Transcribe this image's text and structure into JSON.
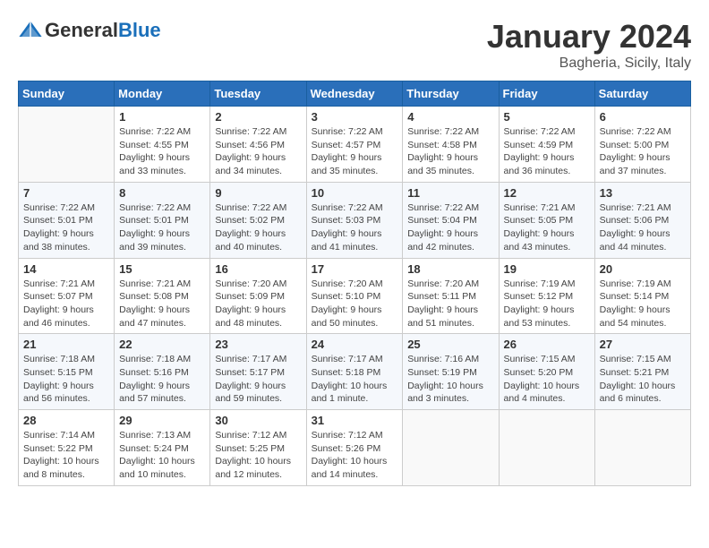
{
  "header": {
    "logo_general": "General",
    "logo_blue": "Blue",
    "month_title": "January 2024",
    "location": "Bagheria, Sicily, Italy"
  },
  "weekdays": [
    "Sunday",
    "Monday",
    "Tuesday",
    "Wednesday",
    "Thursday",
    "Friday",
    "Saturday"
  ],
  "weeks": [
    [
      {
        "day": "",
        "sunrise": "",
        "sunset": "",
        "daylight": ""
      },
      {
        "day": "1",
        "sunrise": "Sunrise: 7:22 AM",
        "sunset": "Sunset: 4:55 PM",
        "daylight": "Daylight: 9 hours and 33 minutes."
      },
      {
        "day": "2",
        "sunrise": "Sunrise: 7:22 AM",
        "sunset": "Sunset: 4:56 PM",
        "daylight": "Daylight: 9 hours and 34 minutes."
      },
      {
        "day": "3",
        "sunrise": "Sunrise: 7:22 AM",
        "sunset": "Sunset: 4:57 PM",
        "daylight": "Daylight: 9 hours and 35 minutes."
      },
      {
        "day": "4",
        "sunrise": "Sunrise: 7:22 AM",
        "sunset": "Sunset: 4:58 PM",
        "daylight": "Daylight: 9 hours and 35 minutes."
      },
      {
        "day": "5",
        "sunrise": "Sunrise: 7:22 AM",
        "sunset": "Sunset: 4:59 PM",
        "daylight": "Daylight: 9 hours and 36 minutes."
      },
      {
        "day": "6",
        "sunrise": "Sunrise: 7:22 AM",
        "sunset": "Sunset: 5:00 PM",
        "daylight": "Daylight: 9 hours and 37 minutes."
      }
    ],
    [
      {
        "day": "7",
        "sunrise": "Sunrise: 7:22 AM",
        "sunset": "Sunset: 5:01 PM",
        "daylight": "Daylight: 9 hours and 38 minutes."
      },
      {
        "day": "8",
        "sunrise": "Sunrise: 7:22 AM",
        "sunset": "Sunset: 5:01 PM",
        "daylight": "Daylight: 9 hours and 39 minutes."
      },
      {
        "day": "9",
        "sunrise": "Sunrise: 7:22 AM",
        "sunset": "Sunset: 5:02 PM",
        "daylight": "Daylight: 9 hours and 40 minutes."
      },
      {
        "day": "10",
        "sunrise": "Sunrise: 7:22 AM",
        "sunset": "Sunset: 5:03 PM",
        "daylight": "Daylight: 9 hours and 41 minutes."
      },
      {
        "day": "11",
        "sunrise": "Sunrise: 7:22 AM",
        "sunset": "Sunset: 5:04 PM",
        "daylight": "Daylight: 9 hours and 42 minutes."
      },
      {
        "day": "12",
        "sunrise": "Sunrise: 7:21 AM",
        "sunset": "Sunset: 5:05 PM",
        "daylight": "Daylight: 9 hours and 43 minutes."
      },
      {
        "day": "13",
        "sunrise": "Sunrise: 7:21 AM",
        "sunset": "Sunset: 5:06 PM",
        "daylight": "Daylight: 9 hours and 44 minutes."
      }
    ],
    [
      {
        "day": "14",
        "sunrise": "Sunrise: 7:21 AM",
        "sunset": "Sunset: 5:07 PM",
        "daylight": "Daylight: 9 hours and 46 minutes."
      },
      {
        "day": "15",
        "sunrise": "Sunrise: 7:21 AM",
        "sunset": "Sunset: 5:08 PM",
        "daylight": "Daylight: 9 hours and 47 minutes."
      },
      {
        "day": "16",
        "sunrise": "Sunrise: 7:20 AM",
        "sunset": "Sunset: 5:09 PM",
        "daylight": "Daylight: 9 hours and 48 minutes."
      },
      {
        "day": "17",
        "sunrise": "Sunrise: 7:20 AM",
        "sunset": "Sunset: 5:10 PM",
        "daylight": "Daylight: 9 hours and 50 minutes."
      },
      {
        "day": "18",
        "sunrise": "Sunrise: 7:20 AM",
        "sunset": "Sunset: 5:11 PM",
        "daylight": "Daylight: 9 hours and 51 minutes."
      },
      {
        "day": "19",
        "sunrise": "Sunrise: 7:19 AM",
        "sunset": "Sunset: 5:12 PM",
        "daylight": "Daylight: 9 hours and 53 minutes."
      },
      {
        "day": "20",
        "sunrise": "Sunrise: 7:19 AM",
        "sunset": "Sunset: 5:14 PM",
        "daylight": "Daylight: 9 hours and 54 minutes."
      }
    ],
    [
      {
        "day": "21",
        "sunrise": "Sunrise: 7:18 AM",
        "sunset": "Sunset: 5:15 PM",
        "daylight": "Daylight: 9 hours and 56 minutes."
      },
      {
        "day": "22",
        "sunrise": "Sunrise: 7:18 AM",
        "sunset": "Sunset: 5:16 PM",
        "daylight": "Daylight: 9 hours and 57 minutes."
      },
      {
        "day": "23",
        "sunrise": "Sunrise: 7:17 AM",
        "sunset": "Sunset: 5:17 PM",
        "daylight": "Daylight: 9 hours and 59 minutes."
      },
      {
        "day": "24",
        "sunrise": "Sunrise: 7:17 AM",
        "sunset": "Sunset: 5:18 PM",
        "daylight": "Daylight: 10 hours and 1 minute."
      },
      {
        "day": "25",
        "sunrise": "Sunrise: 7:16 AM",
        "sunset": "Sunset: 5:19 PM",
        "daylight": "Daylight: 10 hours and 3 minutes."
      },
      {
        "day": "26",
        "sunrise": "Sunrise: 7:15 AM",
        "sunset": "Sunset: 5:20 PM",
        "daylight": "Daylight: 10 hours and 4 minutes."
      },
      {
        "day": "27",
        "sunrise": "Sunrise: 7:15 AM",
        "sunset": "Sunset: 5:21 PM",
        "daylight": "Daylight: 10 hours and 6 minutes."
      }
    ],
    [
      {
        "day": "28",
        "sunrise": "Sunrise: 7:14 AM",
        "sunset": "Sunset: 5:22 PM",
        "daylight": "Daylight: 10 hours and 8 minutes."
      },
      {
        "day": "29",
        "sunrise": "Sunrise: 7:13 AM",
        "sunset": "Sunset: 5:24 PM",
        "daylight": "Daylight: 10 hours and 10 minutes."
      },
      {
        "day": "30",
        "sunrise": "Sunrise: 7:12 AM",
        "sunset": "Sunset: 5:25 PM",
        "daylight": "Daylight: 10 hours and 12 minutes."
      },
      {
        "day": "31",
        "sunrise": "Sunrise: 7:12 AM",
        "sunset": "Sunset: 5:26 PM",
        "daylight": "Daylight: 10 hours and 14 minutes."
      },
      {
        "day": "",
        "sunrise": "",
        "sunset": "",
        "daylight": ""
      },
      {
        "day": "",
        "sunrise": "",
        "sunset": "",
        "daylight": ""
      },
      {
        "day": "",
        "sunrise": "",
        "sunset": "",
        "daylight": ""
      }
    ]
  ]
}
